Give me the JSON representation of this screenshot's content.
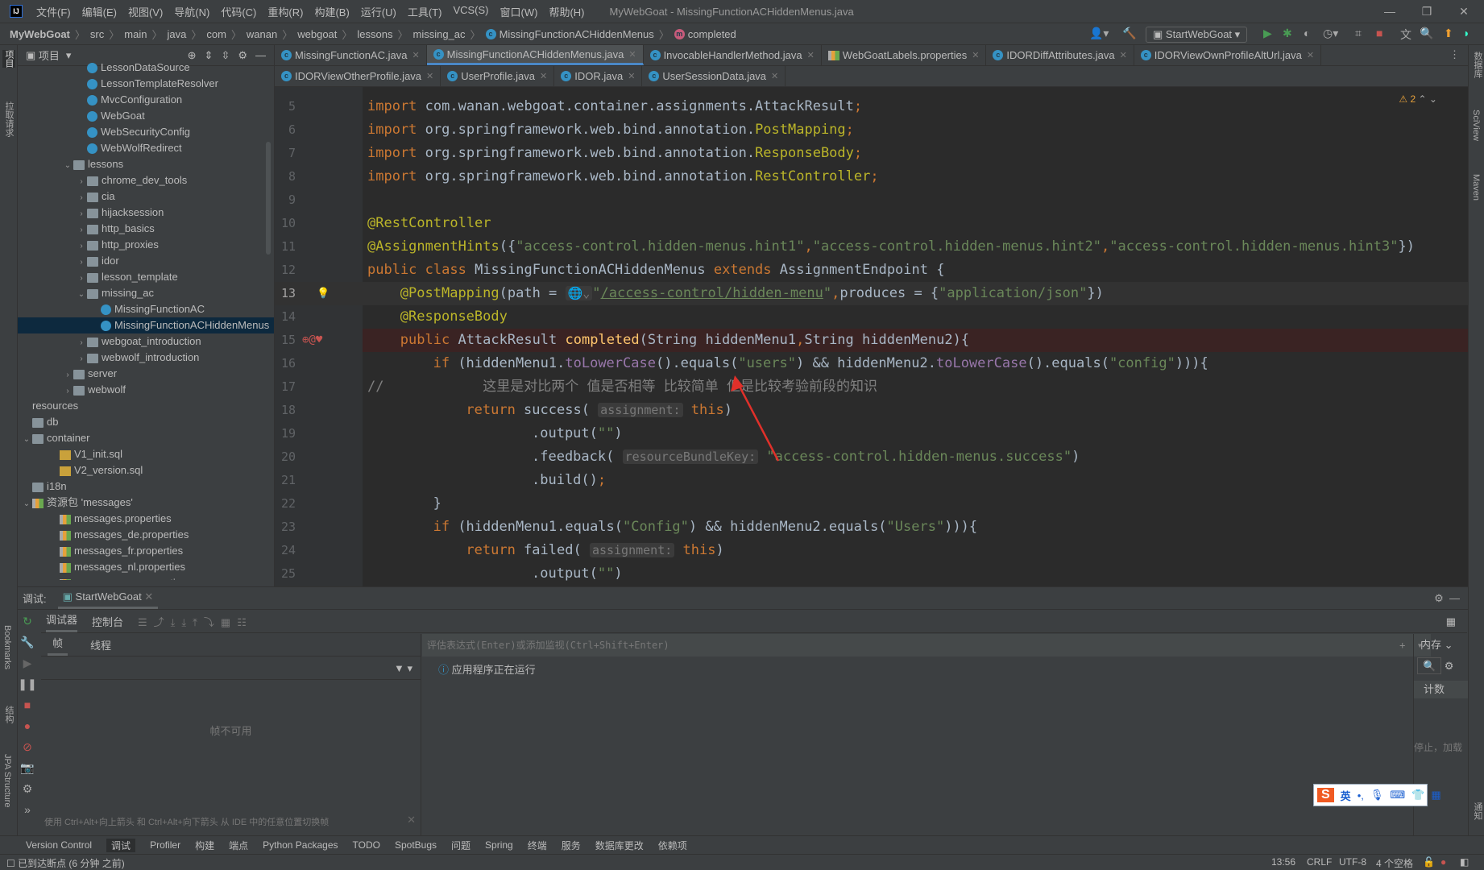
{
  "window": {
    "title": "MyWebGoat - MissingFunctionACHiddenMenus.java",
    "logo": "IJ",
    "menu": [
      "文件(F)",
      "编辑(E)",
      "视图(V)",
      "导航(N)",
      "代码(C)",
      "重构(R)",
      "构建(B)",
      "运行(U)",
      "工具(T)",
      "VCS(S)",
      "窗口(W)",
      "帮助(H)"
    ]
  },
  "breadcrumb": [
    "MyWebGoat",
    "src",
    "main",
    "java",
    "com",
    "wanan",
    "webgoat",
    "lessons",
    "missing_ac",
    "MissingFunctionACHiddenMenus",
    "completed"
  ],
  "toolbar": {
    "run_config": "StartWebGoat"
  },
  "left_stripe": {
    "project": "项目",
    "capture": "拉取请求",
    "bookmarks": "Bookmarks",
    "structure": "结构",
    "jpa": "JPA Structure"
  },
  "right_stripe": {
    "database": "数据库",
    "sciview": "SciView",
    "maven": "Maven",
    "notifications": "通知"
  },
  "project": {
    "header": "项目",
    "tree": [
      {
        "label": "LessonDataSource",
        "type": "class",
        "level": 4
      },
      {
        "label": "LessonTemplateResolver",
        "type": "class",
        "level": 4
      },
      {
        "label": "MvcConfiguration",
        "type": "class",
        "level": 4
      },
      {
        "label": "WebGoat",
        "type": "class",
        "level": 4
      },
      {
        "label": "WebSecurityConfig",
        "type": "class",
        "level": 4
      },
      {
        "label": "WebWolfRedirect",
        "type": "class",
        "level": 4
      },
      {
        "label": "lessons",
        "type": "folder",
        "level": 3,
        "arrow": "open"
      },
      {
        "label": "chrome_dev_tools",
        "type": "folder",
        "level": 4,
        "arrow": "closed"
      },
      {
        "label": "cia",
        "type": "folder",
        "level": 4,
        "arrow": "closed"
      },
      {
        "label": "hijacksession",
        "type": "folder",
        "level": 4,
        "arrow": "closed"
      },
      {
        "label": "http_basics",
        "type": "folder",
        "level": 4,
        "arrow": "closed"
      },
      {
        "label": "http_proxies",
        "type": "folder",
        "level": 4,
        "arrow": "closed"
      },
      {
        "label": "idor",
        "type": "folder",
        "level": 4,
        "arrow": "closed"
      },
      {
        "label": "lesson_template",
        "type": "folder",
        "level": 4,
        "arrow": "closed"
      },
      {
        "label": "missing_ac",
        "type": "folder",
        "level": 4,
        "arrow": "open"
      },
      {
        "label": "MissingFunctionAC",
        "type": "class",
        "level": 5
      },
      {
        "label": "MissingFunctionACHiddenMenus",
        "type": "class",
        "level": 5,
        "selected": true
      },
      {
        "label": "webgoat_introduction",
        "type": "folder",
        "level": 4,
        "arrow": "closed"
      },
      {
        "label": "webwolf_introduction",
        "type": "folder",
        "level": 4,
        "arrow": "closed"
      },
      {
        "label": "server",
        "type": "folder",
        "level": 3,
        "arrow": "closed"
      },
      {
        "label": "webwolf",
        "type": "folder",
        "level": 3,
        "arrow": "closed"
      },
      {
        "label": "resources",
        "type": "none",
        "level": 0
      },
      {
        "label": "db",
        "type": "folder",
        "level": 0
      },
      {
        "label": "container",
        "type": "folder",
        "level": 0,
        "arrow": "open"
      },
      {
        "label": "V1_init.sql",
        "type": "sql",
        "level": 2
      },
      {
        "label": "V2_version.sql",
        "type": "sql",
        "level": 2
      },
      {
        "label": "i18n",
        "type": "folder",
        "level": 0
      },
      {
        "label": "资源包 'messages'",
        "type": "res",
        "level": 0,
        "arrow": "open"
      },
      {
        "label": "messages.properties",
        "type": "props",
        "level": 2
      },
      {
        "label": "messages_de.properties",
        "type": "props",
        "level": 2
      },
      {
        "label": "messages_fr.properties",
        "type": "props",
        "level": 2
      },
      {
        "label": "messages_nl.properties",
        "type": "props",
        "level": 2
      },
      {
        "label": "messages_ru.properties",
        "type": "props",
        "level": 2
      }
    ]
  },
  "tabs": {
    "row1": [
      {
        "label": "MissingFunctionAC.java",
        "icon": "class"
      },
      {
        "label": "MissingFunctionACHiddenMenus.java",
        "icon": "class",
        "active": true
      },
      {
        "label": "InvocableHandlerMethod.java",
        "icon": "class"
      },
      {
        "label": "WebGoatLabels.properties",
        "icon": "props"
      },
      {
        "label": "IDORDiffAttributes.java",
        "icon": "class"
      },
      {
        "label": "IDORViewOwnProfileAltUrl.java",
        "icon": "class"
      }
    ],
    "row2": [
      {
        "label": "IDORViewOtherProfile.java",
        "icon": "class"
      },
      {
        "label": "UserProfile.java",
        "icon": "class"
      },
      {
        "label": "IDOR.java",
        "icon": "class"
      },
      {
        "label": "UserSessionData.java",
        "icon": "class"
      }
    ]
  },
  "editor": {
    "warnings": "2",
    "current_line": 13,
    "breakpoint_line": 15,
    "lines": [
      {
        "n": 5,
        "indent": 0,
        "t": [
          [
            "kw",
            "import "
          ],
          [
            "",
            "com.wanan.webgoat.container.assignments.AttackResult"
          ],
          [
            "kw",
            ";"
          ]
        ]
      },
      {
        "n": 6,
        "indent": 0,
        "t": [
          [
            "kw",
            "import "
          ],
          [
            "",
            "org.springframework.web.bind.annotation."
          ],
          [
            "ann",
            "PostMapping"
          ],
          [
            "kw",
            ";"
          ]
        ]
      },
      {
        "n": 7,
        "indent": 0,
        "t": [
          [
            "kw",
            "import "
          ],
          [
            "",
            "org.springframework.web.bind.annotation."
          ],
          [
            "ann",
            "ResponseBody"
          ],
          [
            "kw",
            ";"
          ]
        ]
      },
      {
        "n": 8,
        "indent": 0,
        "t": [
          [
            "kw",
            "import "
          ],
          [
            "",
            "org.springframework.web.bind.annotation."
          ],
          [
            "ann",
            "RestController"
          ],
          [
            "kw",
            ";"
          ]
        ]
      },
      {
        "n": 9,
        "indent": 0,
        "t": []
      },
      {
        "n": 10,
        "indent": 0,
        "t": [
          [
            "ann",
            "@RestController"
          ]
        ]
      },
      {
        "n": 11,
        "indent": 0,
        "t": [
          [
            "ann",
            "@AssignmentHints"
          ],
          [
            "",
            "({"
          ],
          [
            "str",
            "\"access-control.hidden-menus.hint1\""
          ],
          [
            "kw",
            ","
          ],
          [
            "str",
            "\"access-control.hidden-menus.hint2\""
          ],
          [
            "kw",
            ","
          ],
          [
            "str",
            "\"access-control.hidden-menus.hint3\""
          ],
          [
            "",
            "})"
          ]
        ]
      },
      {
        "n": 12,
        "indent": 0,
        "t": [
          [
            "kw",
            "public class "
          ],
          [
            "",
            "MissingFunctionACHiddenMenus "
          ],
          [
            "kw",
            "extends "
          ],
          [
            "",
            "AssignmentEndpoint {"
          ]
        ]
      },
      {
        "n": 13,
        "indent": 4,
        "t": [
          [
            "ann",
            "@PostMapping"
          ],
          [
            "",
            "(path = "
          ],
          [
            "hint",
            "🌐⌄"
          ],
          [
            "str",
            "\""
          ],
          [
            "url",
            "/access-control/hidden-menu"
          ],
          [
            "str",
            "\""
          ],
          [
            "kw",
            ","
          ],
          [
            "",
            "produces = {"
          ],
          [
            "str",
            "\"application/json\""
          ],
          [
            "",
            "})"
          ]
        ]
      },
      {
        "n": 14,
        "indent": 4,
        "t": [
          [
            "ann",
            "@ResponseBody"
          ]
        ]
      },
      {
        "n": 15,
        "indent": 4,
        "t": [
          [
            "kw",
            "public "
          ],
          [
            "",
            "AttackResult "
          ],
          [
            "fn",
            "completed"
          ],
          [
            "",
            "(String hiddenMenu1"
          ],
          [
            "kw",
            ","
          ],
          [
            "",
            "String hiddenMenu2){"
          ]
        ]
      },
      {
        "n": 16,
        "indent": 8,
        "t": [
          [
            "kw",
            "if "
          ],
          [
            "",
            "(hiddenMenu1."
          ],
          [
            "mc",
            "toLowerCase"
          ],
          [
            "",
            "().equals("
          ],
          [
            "str",
            "\"users\""
          ],
          [
            "",
            ") && hiddenMenu2."
          ],
          [
            "mc",
            "toLowerCase"
          ],
          [
            "",
            "().equals("
          ],
          [
            "str",
            "\"config\""
          ],
          [
            "",
            "))){"
          ]
        ]
      },
      {
        "n": 17,
        "indent": 0,
        "t": [
          [
            "cm",
            "//            这里是对比两个 值是否相等 比较简单 但是比较考验前段的知识"
          ]
        ]
      },
      {
        "n": 18,
        "indent": 12,
        "t": [
          [
            "kw",
            "return "
          ],
          [
            "",
            "success( "
          ],
          [
            "hint",
            "assignment:"
          ],
          [
            "kw",
            " this"
          ],
          [
            "",
            ")"
          ]
        ]
      },
      {
        "n": 19,
        "indent": 20,
        "t": [
          [
            "",
            ".output("
          ],
          [
            "str",
            "\"\""
          ],
          [
            "",
            ")"
          ]
        ]
      },
      {
        "n": 20,
        "indent": 20,
        "t": [
          [
            "",
            ".feedback( "
          ],
          [
            "hint",
            "resourceBundleKey:"
          ],
          [
            "str",
            " \"access-control.hidden-menus.success\""
          ],
          [
            "",
            ")"
          ]
        ]
      },
      {
        "n": 21,
        "indent": 20,
        "t": [
          [
            "",
            ".build()"
          ],
          [
            "kw",
            ";"
          ]
        ]
      },
      {
        "n": 22,
        "indent": 8,
        "t": [
          [
            "",
            "}"
          ]
        ]
      },
      {
        "n": 23,
        "indent": 8,
        "t": [
          [
            "kw",
            "if "
          ],
          [
            "",
            "(hiddenMenu1.equals("
          ],
          [
            "str",
            "\"Config\""
          ],
          [
            "",
            ") && hiddenMenu2.equals("
          ],
          [
            "str",
            "\"Users\""
          ],
          [
            "",
            "))){"
          ]
        ]
      },
      {
        "n": 24,
        "indent": 12,
        "t": [
          [
            "kw",
            "return "
          ],
          [
            "",
            "failed( "
          ],
          [
            "hint",
            "assignment:"
          ],
          [
            "kw",
            " this"
          ],
          [
            "",
            ")"
          ]
        ]
      },
      {
        "n": 25,
        "indent": 20,
        "t": [
          [
            "",
            ".output("
          ],
          [
            "str",
            "\"\""
          ],
          [
            "",
            ")"
          ]
        ]
      }
    ]
  },
  "debug": {
    "label": "调试:",
    "session": "StartWebGoat",
    "tab_debugger": "调试器",
    "tab_console": "控制台",
    "tab_frames": "帧",
    "tab_threads": "线程",
    "frames_empty": "帧不可用",
    "eval_placeholder": "评估表达式(Enter)或添加监视(Ctrl+Shift+Enter)",
    "running": "应用程序正在运行",
    "memory": "内存",
    "count": "计数",
    "stopped_hint": "停止，加载",
    "tip": "使用 Ctrl+Alt+向上箭头 和 Ctrl+Alt+向下箭头 从 IDE 中的任意位置切换帧"
  },
  "toolwindows": [
    "Version Control",
    "调试",
    "Profiler",
    "构建",
    "端点",
    "Python Packages",
    "TODO",
    "SpotBugs",
    "问题",
    "Spring",
    "终端",
    "服务",
    "数据库更改",
    "依赖项"
  ],
  "status": {
    "message": "已到达断点 (6 分钟 之前)",
    "position": "13:56",
    "line_sep": "CRLF",
    "encoding": "UTF-8",
    "indent": "4 个空格"
  },
  "ime": {
    "lang": "英",
    "punct": "•,"
  },
  "colors": {
    "accent": "#4a88c7",
    "breakpoint_line": "#3a2323",
    "selection": "#0d293e",
    "annotation_arrow": "#e0302a"
  }
}
